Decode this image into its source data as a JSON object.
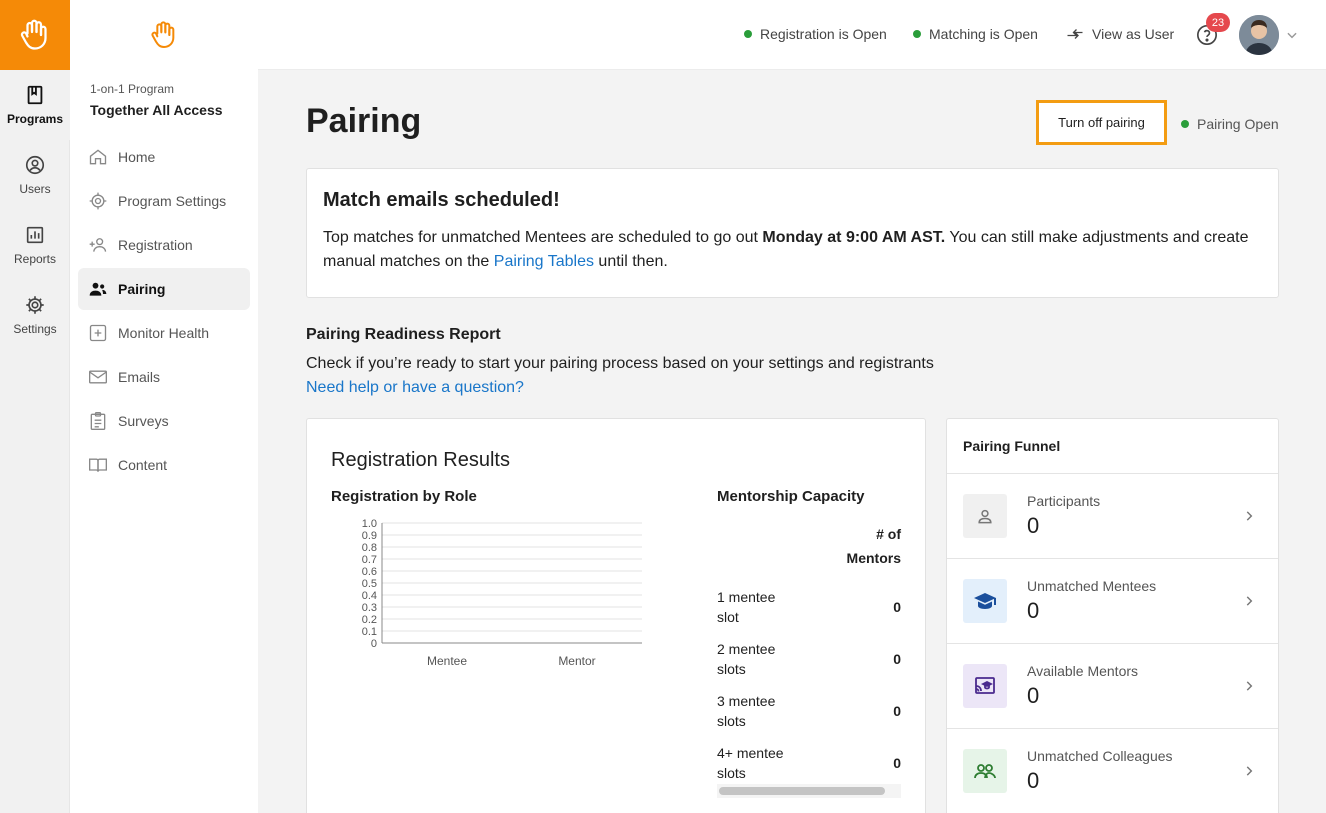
{
  "rail": {
    "items": [
      {
        "label": "Programs",
        "icon": "book-icon"
      },
      {
        "label": "Users",
        "icon": "user-circle-icon"
      },
      {
        "label": "Reports",
        "icon": "bar-chart-icon"
      },
      {
        "label": "Settings",
        "icon": "gear-icon"
      }
    ]
  },
  "program": {
    "subtitle": "1-on-1 Program",
    "name": "Together All Access"
  },
  "sidebar": {
    "items": [
      {
        "label": "Home",
        "icon": "home-icon"
      },
      {
        "label": "Program Settings",
        "icon": "gear-icon"
      },
      {
        "label": "Registration",
        "icon": "add-user-icon"
      },
      {
        "label": "Pairing",
        "icon": "people-icon"
      },
      {
        "label": "Monitor Health",
        "icon": "plus-square-icon"
      },
      {
        "label": "Emails",
        "icon": "mail-icon"
      },
      {
        "label": "Surveys",
        "icon": "clipboard-icon"
      },
      {
        "label": "Content",
        "icon": "book-open-icon"
      }
    ]
  },
  "topbar": {
    "registration_status": "Registration is Open",
    "matching_status": "Matching is Open",
    "view_as_user": "View as User",
    "notification_count": "23"
  },
  "page": {
    "title": "Pairing",
    "turn_off_label": "Turn off pairing",
    "pairing_status": "Pairing Open"
  },
  "alert": {
    "title": "Match emails scheduled!",
    "text_before": "Top matches for unmatched Mentees are scheduled to go out ",
    "text_bold": "Monday at 9:00 AM AST.",
    "text_middle": " You can still make adjustments and create manual matches on the ",
    "link": "Pairing Tables",
    "text_after": " until then."
  },
  "readiness": {
    "title": "Pairing Readiness Report",
    "description": "Check if you’re ready to start your pairing process based on your settings and registrants",
    "help_link": "Need help or have a question?"
  },
  "registration": {
    "title": "Registration Results",
    "chart_title": "Registration by Role",
    "capacity_title": "Mentorship Capacity",
    "capacity_header_1": "# of",
    "capacity_header_2": "Mentors",
    "capacity_rows": [
      {
        "label_1": "1 mentee",
        "label_2": "slot",
        "value": "0"
      },
      {
        "label_1": "2 mentee",
        "label_2": "slots",
        "value": "0"
      },
      {
        "label_1": "3 mentee",
        "label_2": "slots",
        "value": "0"
      },
      {
        "label_1": "4+ mentee",
        "label_2": "slots",
        "value": "0"
      }
    ]
  },
  "chart_data": {
    "type": "bar",
    "title": "Registration by Role",
    "categories": [
      "Mentee",
      "Mentor"
    ],
    "values": [
      0,
      0
    ],
    "ylim": [
      0,
      1.0
    ],
    "yticks": [
      "1.0",
      "0.9",
      "0.8",
      "0.7",
      "0.6",
      "0.5",
      "0.4",
      "0.3",
      "0.2",
      "0.1",
      "0"
    ],
    "grid": true,
    "xlabel": "",
    "ylabel": ""
  },
  "funnel": {
    "title": "Pairing Funnel",
    "rows": [
      {
        "label": "Participants",
        "value": "0",
        "icon": "person-icon",
        "bg": "#f0f0f0",
        "color": "#777777"
      },
      {
        "label": "Unmatched Mentees",
        "value": "0",
        "icon": "graduation-cap-icon",
        "bg": "#e3effb",
        "color": "#1b4f9c"
      },
      {
        "label": "Available Mentors",
        "value": "0",
        "icon": "teacher-board-icon",
        "bg": "#ece6f7",
        "color": "#4a2a8e"
      },
      {
        "label": "Unmatched Colleagues",
        "value": "0",
        "icon": "people-icon",
        "bg": "#e6f4e8",
        "color": "#2e7d32"
      }
    ]
  },
  "colors": {
    "brand": "#f58a07",
    "accent_border": "#f39c12",
    "status_green": "#2a9d3a",
    "link": "#1976c9",
    "badge": "#e5484d"
  }
}
